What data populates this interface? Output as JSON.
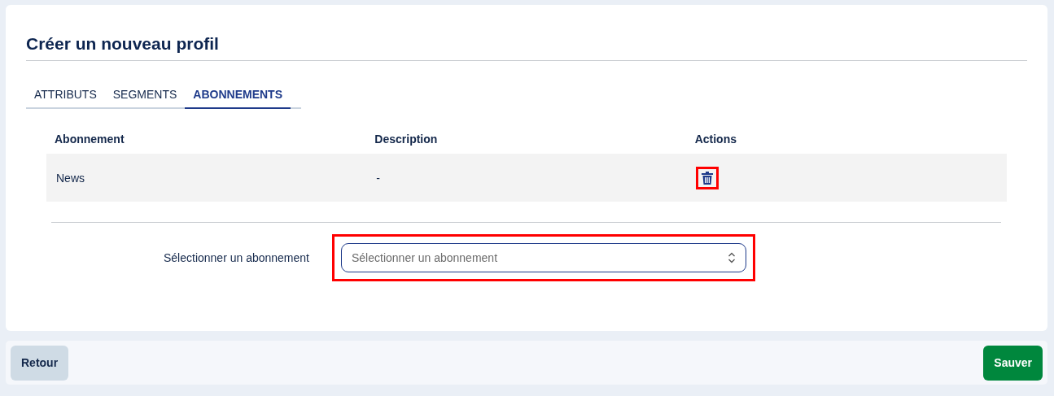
{
  "title": "Créer un nouveau profil",
  "tabs": [
    {
      "label": "ATTRIBUTS",
      "selected": false
    },
    {
      "label": "SEGMENTS",
      "selected": false
    },
    {
      "label": "ABONNEMENTS",
      "selected": true
    }
  ],
  "table": {
    "columns": [
      "Abonnement",
      "Description",
      "Actions"
    ],
    "rows": [
      {
        "abonnement": "News",
        "description": "-",
        "delete_highlighted": true
      }
    ]
  },
  "select": {
    "label": "Sélectionner un abonnement",
    "placeholder": "Sélectionner un abonnement",
    "highlighted": true
  },
  "buttons": {
    "back": "Retour",
    "save": "Sauver"
  }
}
